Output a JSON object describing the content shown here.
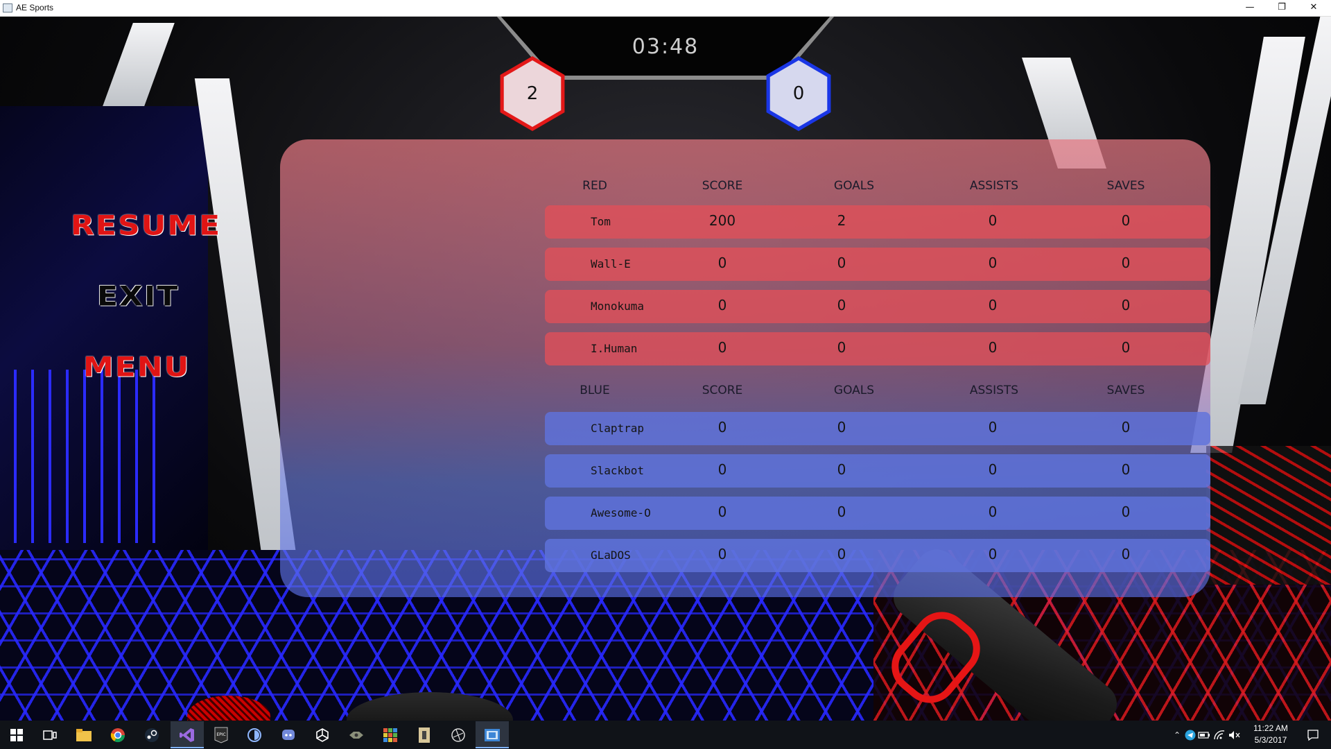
{
  "window": {
    "title": "AE Sports",
    "minimize_icon": "minimize-icon",
    "maximize_icon": "restore-icon",
    "close_icon": "close-icon"
  },
  "hud": {
    "timer": "03:48",
    "red_score": "2",
    "blue_score": "0",
    "colors": {
      "red": "#e31818",
      "blue": "#1a36e6"
    }
  },
  "menu": {
    "resume": "RESUME",
    "exit": "EXIT",
    "menu": "MENU"
  },
  "scoreboard": {
    "columns": [
      "SCORE",
      "GOALS",
      "ASSISTS",
      "SAVES"
    ],
    "red": {
      "label": "RED",
      "players": [
        {
          "name": "Tom",
          "score": "200",
          "goals": "2",
          "assists": "0",
          "saves": "0"
        },
        {
          "name": "Wall-E",
          "score": "0",
          "goals": "0",
          "assists": "0",
          "saves": "0"
        },
        {
          "name": "Monokuma",
          "score": "0",
          "goals": "0",
          "assists": "0",
          "saves": "0"
        },
        {
          "name": "I.Human",
          "score": "0",
          "goals": "0",
          "assists": "0",
          "saves": "0"
        }
      ]
    },
    "blue": {
      "label": "BLUE",
      "players": [
        {
          "name": "Claptrap",
          "score": "0",
          "goals": "0",
          "assists": "0",
          "saves": "0"
        },
        {
          "name": "Slackbot",
          "score": "0",
          "goals": "0",
          "assists": "0",
          "saves": "0"
        },
        {
          "name": "Awesome-O",
          "score": "0",
          "goals": "0",
          "assists": "0",
          "saves": "0"
        },
        {
          "name": "GLaDOS",
          "score": "0",
          "goals": "0",
          "assists": "0",
          "saves": "0"
        }
      ]
    }
  },
  "taskbar": {
    "icons": [
      "windows-start-icon",
      "task-view-icon",
      "file-explorer-icon",
      "chrome-icon",
      "steam-icon",
      "visual-studio-icon",
      "epic-games-icon",
      "app-icon",
      "discord-icon",
      "unity-icon",
      "game-icon",
      "app-grid-icon",
      "app-icon",
      "app-icon",
      "ae-sports-icon"
    ],
    "time": "11:22 AM",
    "date": "5/3/2017"
  }
}
